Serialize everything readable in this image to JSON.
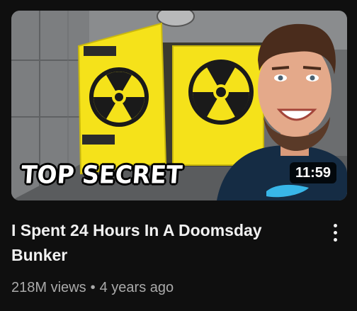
{
  "video": {
    "thumbnail_text": "TOP SECRET",
    "duration": "11:59",
    "title": "I Spent 24 Hours In A Doomsday Bunker",
    "views": "218M views",
    "separator": "•",
    "age": "4 years ago"
  },
  "icons": {
    "more": "more-vert-icon"
  },
  "colors": {
    "background": "#0f0f0f",
    "title": "#f1f1f1",
    "meta": "#aaaaaa",
    "door_yellow": "#f5e21a"
  }
}
